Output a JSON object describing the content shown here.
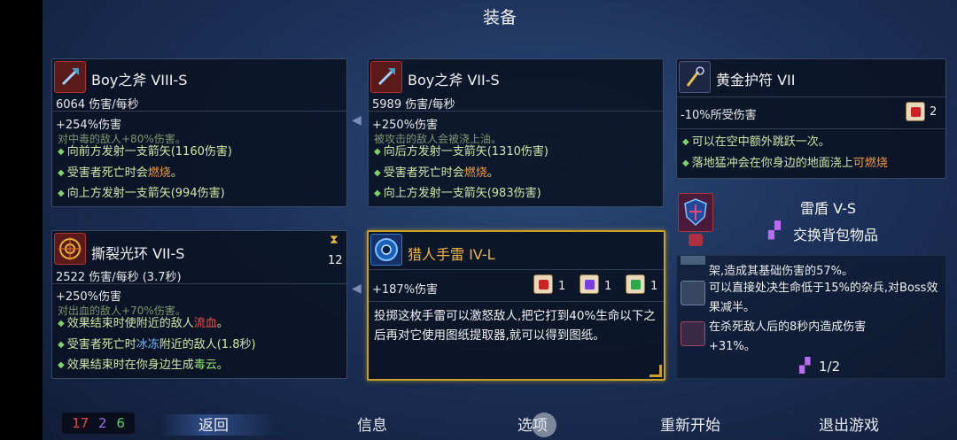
{
  "header": {
    "title": "装备"
  },
  "weapon1": {
    "name": "Boy之斧 VIII-S",
    "dps": "6064 伤害/每秒",
    "bonus": "+254%伤害",
    "cut_line": "对中毒的敌人+80%伤害。",
    "affix1": "向前方发射一支箭矢(1160伤害)",
    "affix2_pre": "受害者死亡时会",
    "affix2_hl": "燃烧",
    "affix2_post": "。",
    "affix3": "向上方发射一支箭矢(994伤害)"
  },
  "weapon2": {
    "name": "Boy之斧 VII-S",
    "dps": "5989 伤害/每秒",
    "bonus": "+250%伤害",
    "cut_line": "被攻击的敌人会被浇上油。",
    "affix1": "向后方发射一支箭矢(1310伤害)",
    "affix2_pre": "受害者死亡时会",
    "affix2_hl": "燃烧",
    "affix2_post": "。",
    "affix3": "向上方发射一支箭矢(983伤害)"
  },
  "amulet": {
    "name": "黄金护符 VII",
    "stat": "-10%所受伤害",
    "scroll_count": "2",
    "line1": "可以在空中额外跳跃一次。",
    "line2_pre": "落地猛冲会在你身边的地面浇上",
    "line2_hl": "可燃烧"
  },
  "skill1": {
    "name": "撕裂光环 VII-S",
    "cooldown": "12",
    "dps": "2522 伤害/每秒 (3.7秒)",
    "bonus": "+250%伤害",
    "cut_line": "对出血的敌人+70%伤害。",
    "affix1_pre": "效果结束时使附近的敌人",
    "affix1_hl": "流血",
    "affix1_post": "。",
    "affix2_pre": "受害者死亡时",
    "affix2_hl": "冰冻",
    "affix2_post": "附近的敌人(1.8秒)",
    "affix3_pre": "效果结束时在你身边生成",
    "affix3_hl": "毒云",
    "affix3_post": "。"
  },
  "skill2": {
    "name": "猎人手雷 IV-L",
    "bonus": "+187%伤害",
    "scroll1": "1",
    "scroll2": "1",
    "scroll3": "1",
    "desc": "投掷这枚手雷可以激怒敌人,把它打到40%生命以下之后再对它使用图纸提取器,就可以得到图纸。"
  },
  "shield": {
    "name": "雷盾 V-S",
    "swap_label": "交换背包物品",
    "cut_line": "架,造成其基础伤害的57%。",
    "affix1": "可以直接处决生命低于15%的杂兵,对Boss效果减半。",
    "affix2": "在杀死敌人后的8秒内造成伤害+31%。",
    "page": "1/2"
  },
  "footer": {
    "count_red": "17",
    "count_purple": "2",
    "count_green": "6",
    "back": "返回",
    "info": "信息",
    "options": "选项",
    "restart": "重新开始",
    "quit": "退出游戏"
  },
  "colors": {
    "accent_gold": "#c9a227",
    "affix_green": "#7fd36a",
    "highlight_orange": "#f09a3a"
  }
}
